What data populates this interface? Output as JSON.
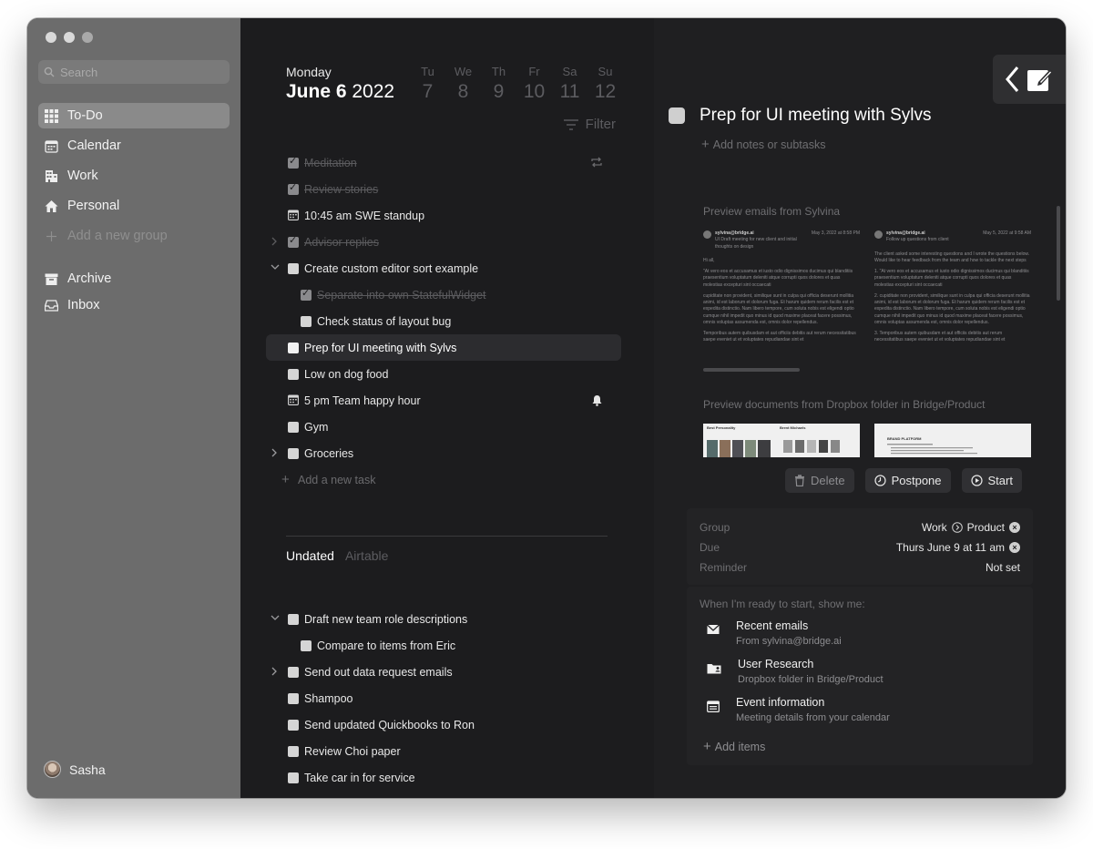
{
  "sidebar": {
    "search_placeholder": "Search",
    "items": [
      {
        "label": "To-Do"
      },
      {
        "label": "Calendar"
      },
      {
        "label": "Work"
      },
      {
        "label": "Personal"
      },
      {
        "label": "Add a new group"
      }
    ],
    "bottom_items": [
      {
        "label": "Archive"
      },
      {
        "label": "Inbox"
      }
    ],
    "user_name": "Sasha"
  },
  "header": {
    "day_of_week": "Monday",
    "date_bold": "June 6",
    "year": "2022",
    "week": [
      {
        "name": "Tu",
        "num": "7"
      },
      {
        "name": "We",
        "num": "8"
      },
      {
        "name": "Th",
        "num": "9"
      },
      {
        "name": "Fr",
        "num": "10"
      },
      {
        "name": "Sa",
        "num": "11"
      },
      {
        "name": "Su",
        "num": "12"
      }
    ],
    "filter_label": "Filter"
  },
  "tasks": [
    {
      "label": "Meditation"
    },
    {
      "label": "Review stories"
    },
    {
      "label": "10:45 am SWE standup"
    },
    {
      "label": "Advisor replies"
    },
    {
      "label": "Create custom editor sort example"
    },
    {
      "label": "Separate into own StatefulWidget"
    },
    {
      "label": "Check status of layout bug"
    },
    {
      "label": "Prep for UI meeting with Sylvs"
    },
    {
      "label": "Low on dog food"
    },
    {
      "label": "5 pm Team happy hour"
    },
    {
      "label": "Gym"
    },
    {
      "label": "Groceries"
    }
  ],
  "add_task_label": "Add a new task",
  "tabs": {
    "active": "Undated",
    "inactive": "Airtable"
  },
  "undated_tasks": [
    {
      "label": "Draft new team role descriptions"
    },
    {
      "label": "Compare to items from Eric"
    },
    {
      "label": "Send out data request emails"
    },
    {
      "label": "Shampoo"
    },
    {
      "label": "Send updated Quickbooks to Ron"
    },
    {
      "label": "Review Choi paper"
    },
    {
      "label": "Take car in for service"
    }
  ],
  "detail": {
    "title": "Prep for UI meeting with Sylvs",
    "add_notes": "Add notes or subtasks",
    "emails_label": "Preview emails from Sylvina",
    "email1": {
      "from": "sylvina@bridge.ai",
      "subject": "UI Draft meeting for new client and initial thoughts on design",
      "date": "May 3, 2022 at 8:58 PM",
      "greeting": "Hi all,",
      "p1": "\"At vero eos et accusamus et iusto odio dignissimos ducimus qui blanditiis praesentium voluptatum deleniti atque corrupti quos dolores et quas molestias excepturi sint occaecati",
      "p2": "cupiditate non provident, similique sunt in culpa qui officia deserunt mollitia animi, id est laborum et dolorum fuga. Et harum quidem rerum facilis est et expedita distinctio. Nam libero tempore, cum soluta nobis est eligendi optio cumque nihil impedit quo minus id quod maxime placeat facere possimus, omnis voluptas assumenda est, omnis dolor repellendus.",
      "p3": "Temporibus autem quibusdam et aut officiis debitis aut rerum necessitatibus saepe eveniet ut et voluptates repudiandae sint et"
    },
    "email2": {
      "from": "sylvina@bridge.ai",
      "subject": "Follow up questions from client",
      "date": "May 5, 2022 at 9:58 AM",
      "p1": "The client asked some interesting questions and I wrote the questions below. Would like to hear feedback from the team and how to tackle the next steps",
      "li1": "\"At vero eos et accusamus et iusto odio dignissimos ducimus qui blanditiis praesentium voluptatum deleniti atque corrupti quos dolores et quas molestias excepturi sint occaecati",
      "li2": "cupiditate non provident, similique sunt in culpa qui officia deserunt mollitia animi, id est laborum et dolorum fuga. Et harum quidem rerum facilis est et expedita distinctio. Nam libero tempore, cum soluta nobis est eligendi optio cumque nihil impedit quo minus id quod maxime placeat facere possimus, omnis voluptas assumenda est, omnis dolor repellendus.",
      "li3": "Temporibus autem quibusdam et aut officiis debitis aut rerum necessitatibus saepe eveniet ut et voluptates repudiandae sint et"
    },
    "docs_label": "Preview documents from Dropbox folder in Bridge/Product",
    "doc1_title": "Best Personality",
    "doc1_title_b": "Brent Michaels",
    "doc2_title": "BRAND PLATFORM",
    "actions": {
      "delete": "Delete",
      "postpone": "Postpone",
      "start": "Start"
    },
    "props": {
      "group_label": "Group",
      "group_value": "Work",
      "group_sub": "Product",
      "due_label": "Due",
      "due_value": "Thurs June 9 at 11 am",
      "reminder_label": "Reminder",
      "reminder_value": "Not set"
    },
    "show_label": "When I'm ready to start, show me:",
    "show_items": [
      {
        "title": "Recent emails",
        "sub": "From sylvina@bridge.ai"
      },
      {
        "title": "User Research",
        "sub": "Dropbox folder in Bridge/Product"
      },
      {
        "title": "Event information",
        "sub": "Meeting details from your calendar"
      }
    ],
    "add_items": "Add items"
  }
}
